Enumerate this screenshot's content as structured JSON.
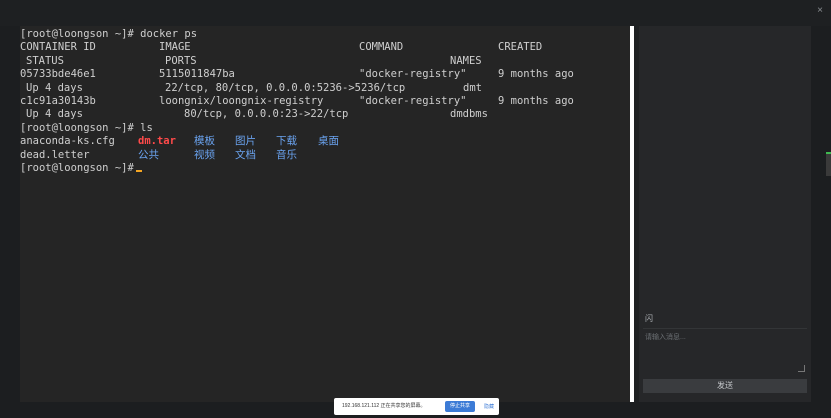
{
  "window": {
    "close_glyph": "×"
  },
  "terminal": {
    "prompt": "[root@loongson ~]#",
    "cmd1": " docker ps",
    "headers": {
      "container_id": "CONTAINER ID",
      "image": "IMAGE",
      "command": "COMMAND",
      "created": "CREATED",
      "status": "STATUS",
      "ports": "PORTS",
      "names": "NAMES"
    },
    "containers": [
      {
        "id": "05733bde46e1",
        "image": "5115011847ba",
        "command": "\"docker-registry\"",
        "created": "9 months ago",
        "status": "Up 4 days",
        "ports": "22/tcp, 80/tcp, 0.0.0.0:5236->5236/tcp",
        "names": "dmt"
      },
      {
        "id": "c1c91a30143b",
        "image": "loongnix/loongnix-registry",
        "command": "\"docker-registry\"",
        "created": "9 months ago",
        "status": "Up 4 days",
        "ports": "80/tcp, 0.0.0.0:23->22/tcp",
        "names": "dmdbms"
      }
    ],
    "cmd2": " ls",
    "ls_row1": {
      "file": "anaconda-ks.cfg",
      "archive": "dm.tar",
      "dir1": "模板",
      "dir2": "图片",
      "dir3": "下载",
      "dir4": "桌面"
    },
    "ls_row2": {
      "file": "dead.letter",
      "dir1": "公共",
      "dir2": "视频",
      "dir3": "文档",
      "dir4": "音乐"
    },
    "colors": {
      "text": "#cfcfcf",
      "archive": "#ff4a4a",
      "directory": "#6aa3f0",
      "cursor": "#f5a623",
      "background": "#252525"
    }
  },
  "chat": {
    "title": "闪",
    "input_placeholder": "请输入消息...",
    "send_label": "发送"
  },
  "notification": {
    "text": "192.168.121.112 正在共享您的屏幕。",
    "stop_label": "停止共享",
    "hide_label": "隐藏"
  }
}
